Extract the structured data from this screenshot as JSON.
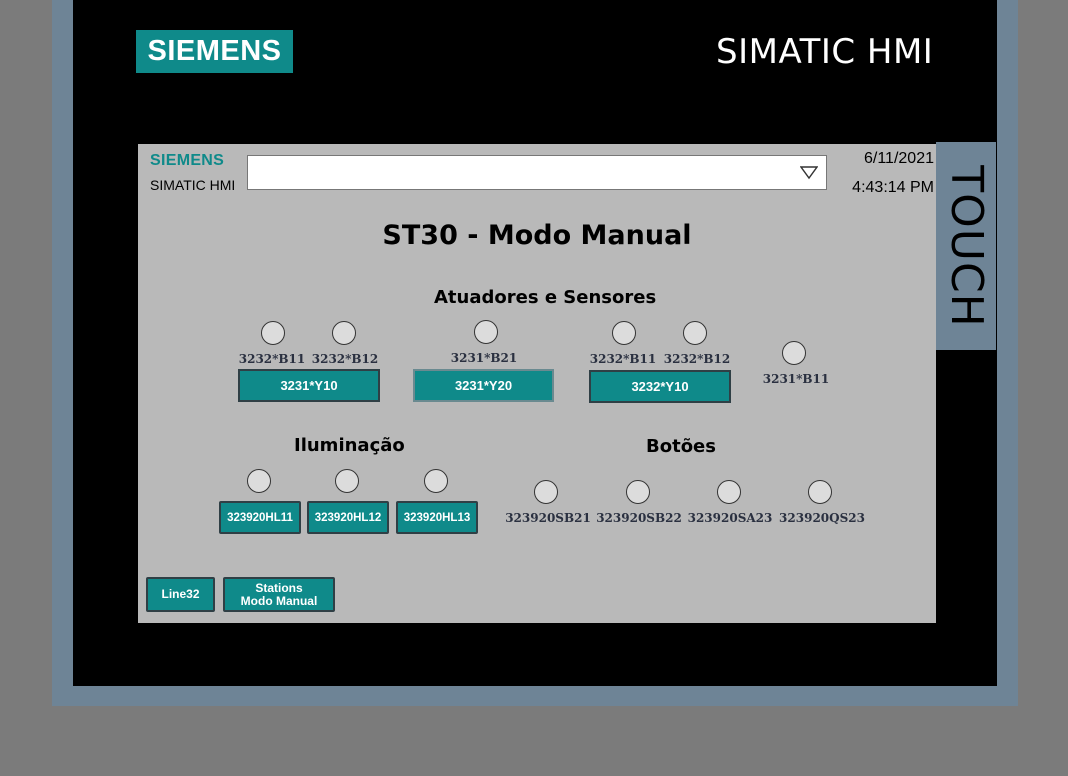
{
  "bezel": {
    "logo_text": "SIEMENS",
    "product_text": "SIMATIC HMI",
    "touch_text": "TOUCH"
  },
  "header": {
    "logo_text": "SIEMENS",
    "product_text": "SIMATIC HMI",
    "dropdown_value": "",
    "date": "6/11/2021",
    "time": "4:43:14 PM"
  },
  "page": {
    "title": "ST30 - Modo Manual"
  },
  "atuadores": {
    "heading": "Atuadores e Sensores",
    "group1": {
      "sensor1": "3232*B11",
      "sensor2": "3232*B12",
      "button": "3231*Y10"
    },
    "group2": {
      "sensor1": "3231*B21",
      "button": "3231*Y20"
    },
    "group3": {
      "sensor1": "3232*B11",
      "sensor2": "3232*B12",
      "button": "3232*Y10"
    },
    "extra_sensor": "3231*B11"
  },
  "iluminacao": {
    "heading": "Iluminação",
    "buttons": [
      "323920HL11",
      "323920HL12",
      "323920HL13"
    ]
  },
  "botoes": {
    "heading": "Botões",
    "labels": [
      "323920SB21",
      "323920SB22",
      "323920SA23",
      "323920QS23"
    ]
  },
  "nav": {
    "line_button": "Line32",
    "stations_line1": "Stations",
    "stations_line2": "Modo Manual"
  },
  "colors": {
    "accent_teal": "#0f8a8a",
    "screen_bg": "#b9b9b9",
    "frame_blue": "#6e8496",
    "indicator_off": "#dcdcdc"
  }
}
